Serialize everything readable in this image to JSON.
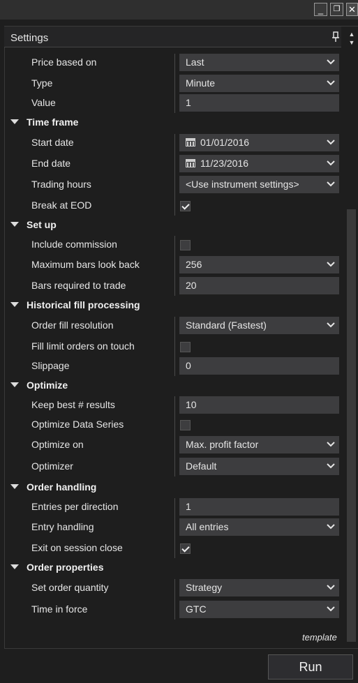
{
  "window": {
    "minimize_glyph": "_",
    "restore_glyph": "❐",
    "close_glyph": "✕"
  },
  "panel": {
    "title": "Settings",
    "pin_glyph": "📌"
  },
  "rows": [
    {
      "type": "prop",
      "label": "Price based on",
      "control": "dropdown",
      "value": "Last"
    },
    {
      "type": "prop",
      "label": "Type",
      "control": "dropdown",
      "value": "Minute"
    },
    {
      "type": "prop",
      "label": "Value",
      "control": "input",
      "value": "1"
    },
    {
      "type": "category",
      "label": "Time frame"
    },
    {
      "type": "prop",
      "label": "Start date",
      "control": "date",
      "value": "01/01/2016"
    },
    {
      "type": "prop",
      "label": "End date",
      "control": "date",
      "value": "11/23/2016"
    },
    {
      "type": "prop",
      "label": "Trading hours",
      "control": "dropdown",
      "value": "<Use instrument settings>"
    },
    {
      "type": "prop",
      "label": "Break at EOD",
      "control": "checkbox",
      "checked": true
    },
    {
      "type": "category",
      "label": "Set up"
    },
    {
      "type": "prop",
      "label": "Include commission",
      "control": "checkbox",
      "checked": false
    },
    {
      "type": "prop",
      "label": "Maximum bars look back",
      "control": "dropdown",
      "value": "256"
    },
    {
      "type": "prop",
      "label": "Bars required to trade",
      "control": "input",
      "value": "20"
    },
    {
      "type": "category",
      "label": "Historical fill processing"
    },
    {
      "type": "prop",
      "label": "Order fill resolution",
      "control": "dropdown",
      "value": "Standard (Fastest)"
    },
    {
      "type": "prop",
      "label": "Fill limit orders on touch",
      "control": "checkbox",
      "checked": false
    },
    {
      "type": "prop",
      "label": "Slippage",
      "control": "input",
      "value": "0"
    },
    {
      "type": "category",
      "label": "Optimize"
    },
    {
      "type": "prop",
      "label": "Keep best # results",
      "control": "input",
      "value": "10"
    },
    {
      "type": "prop",
      "label": "Optimize Data Series",
      "control": "checkbox",
      "checked": false
    },
    {
      "type": "prop",
      "label": "Optimize on",
      "control": "dropdown",
      "value": "Max. profit factor"
    },
    {
      "type": "prop",
      "label": "Optimizer",
      "control": "dropdown",
      "value": "Default"
    },
    {
      "type": "category",
      "label": "Order handling"
    },
    {
      "type": "prop",
      "label": "Entries per direction",
      "control": "input",
      "value": "1"
    },
    {
      "type": "prop",
      "label": "Entry handling",
      "control": "dropdown",
      "value": "All entries"
    },
    {
      "type": "prop",
      "label": "Exit on session close",
      "control": "checkbox",
      "checked": true
    },
    {
      "type": "category",
      "label": "Order properties"
    },
    {
      "type": "prop",
      "label": "Set order quantity",
      "control": "dropdown",
      "value": "Strategy"
    },
    {
      "type": "prop",
      "label": "Time in force",
      "control": "dropdown",
      "value": "GTC"
    }
  ],
  "footer": {
    "template_label": "template",
    "run_label": "Run"
  },
  "colors": {
    "background": "#1e1e1e",
    "field": "#3d3d3f",
    "text": "#e6e6e6"
  }
}
